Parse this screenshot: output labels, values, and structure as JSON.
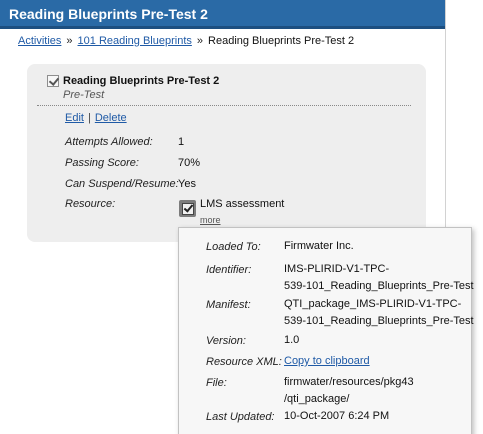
{
  "header": {
    "title": "Reading Blueprints Pre-Test 2"
  },
  "breadcrumb": {
    "items": [
      "Activities",
      "101 Reading Blueprints"
    ],
    "separator": "»",
    "current": "Reading Blueprints Pre-Test 2"
  },
  "card": {
    "title": "Reading Blueprints Pre-Test 2",
    "subtitle": "Pre-Test",
    "actions": {
      "edit": "Edit",
      "separator": "|",
      "delete": "Delete"
    },
    "fields": {
      "attempts": {
        "label": "Attempts Allowed:",
        "value": "1"
      },
      "passing": {
        "label": "Passing Score:",
        "value": "70%"
      },
      "suspend": {
        "label": "Can Suspend/Resume:",
        "value": "Yes"
      },
      "resource": {
        "label": "Resource:",
        "name": "LMS assessment",
        "more": "more",
        "icon": "checkbox-document-icon"
      }
    }
  },
  "popup": {
    "loaded_to": {
      "label": "Loaded To:",
      "value": "Firmwater Inc."
    },
    "identifier": {
      "label": "Identifier:",
      "line1": "IMS-PLIRID-V1-TPC-",
      "line2": "539-101_Reading_Blueprints_Pre-Test"
    },
    "manifest": {
      "label": "Manifest:",
      "line1": "QTI_package_IMS-PLIRID-V1-TPC-",
      "line2": "539-101_Reading_Blueprints_Pre-Test"
    },
    "version": {
      "label": "Version:",
      "value": "1.0"
    },
    "resource_xml": {
      "label": "Resource XML:",
      "link": "Copy to clipboard"
    },
    "file": {
      "label": "File:",
      "line1": "firmwater/resources/pkg43",
      "line2": "/qti_package/"
    },
    "last_updated": {
      "label": "Last Updated:",
      "value": "10-Oct-2007 6:24 PM"
    }
  },
  "colors": {
    "title_bar": "#2a6aa6",
    "link": "#1f5aa6",
    "card_bg": "#eeeeee"
  }
}
